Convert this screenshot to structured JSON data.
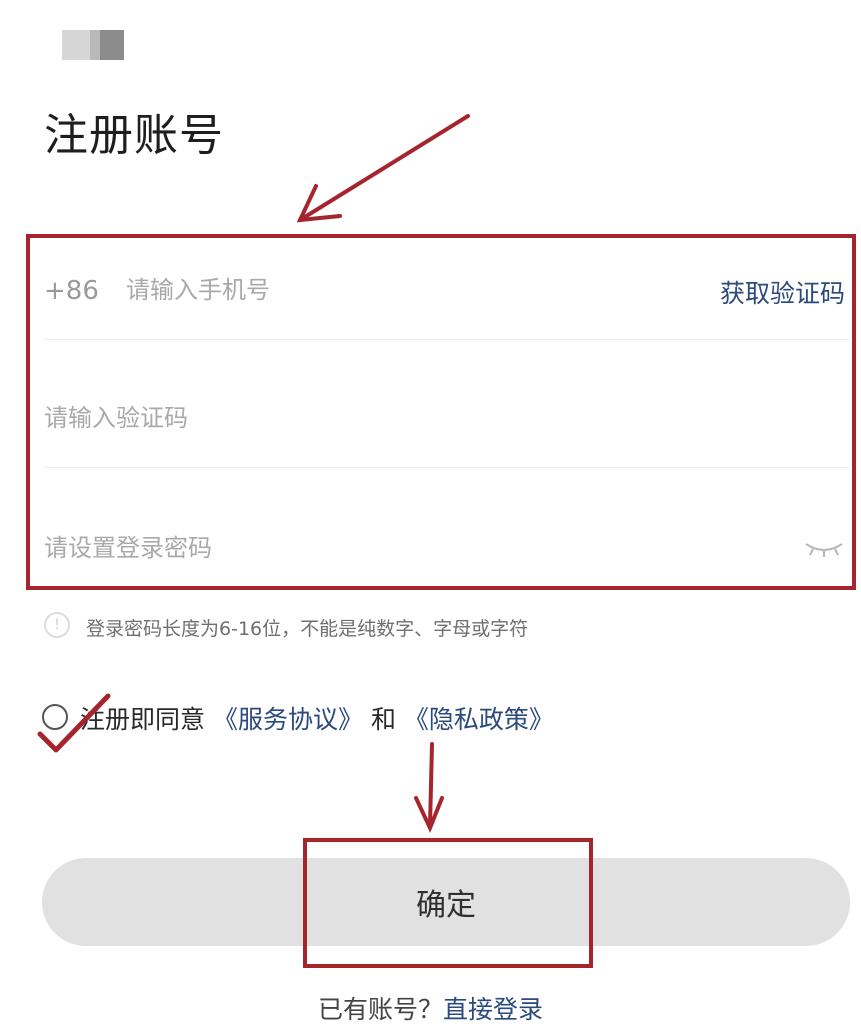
{
  "header": {
    "title": "注册账号"
  },
  "form": {
    "phone": {
      "country_code": "+86",
      "placeholder": "请输入手机号",
      "value": "",
      "get_code_label": "获取验证码"
    },
    "code": {
      "placeholder": "请输入验证码",
      "value": ""
    },
    "password": {
      "placeholder": "请设置登录密码",
      "value": ""
    },
    "password_hint": "登录密码长度为6-16位，不能是纯数字、字母或字符"
  },
  "agreement": {
    "prefix": "注册即同意",
    "service_link": "《服务协议》",
    "conjunction": "和",
    "privacy_link": "《隐私政策》",
    "checked": false
  },
  "actions": {
    "confirm_label": "确定"
  },
  "footer": {
    "have_account": "已有账号？",
    "login_link": "直接登录"
  },
  "colors": {
    "annotation_red": "#a4262c",
    "link_blue": "#2b4a7e",
    "button_gray": "#e1e1e1"
  },
  "icons": [
    "info-icon",
    "eye-closed-icon",
    "radio-unchecked-icon"
  ]
}
